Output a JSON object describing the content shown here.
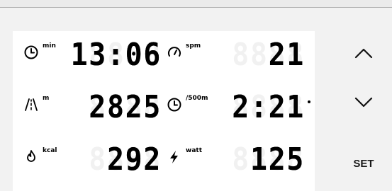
{
  "metrics": {
    "time": {
      "unit": "min",
      "value": "13:06",
      "icon": "clock-icon"
    },
    "stroke_rate": {
      "unit": "spm",
      "value": "21",
      "icon": "gauge-icon"
    },
    "distance": {
      "unit": "m",
      "value": "2825",
      "icon": "road-icon"
    },
    "split": {
      "unit": "/500m",
      "value": "2:21",
      "icon": "clock-icon"
    },
    "calories": {
      "unit": "kcal",
      "value": "292",
      "icon": "flame-icon"
    },
    "power": {
      "unit": "watt",
      "value": "125",
      "icon": "lightning-icon"
    }
  },
  "ghost_digits": "8888",
  "controls": {
    "up_icon": "chevron-up-icon",
    "down_icon": "chevron-down-icon",
    "set_label": "SET"
  }
}
